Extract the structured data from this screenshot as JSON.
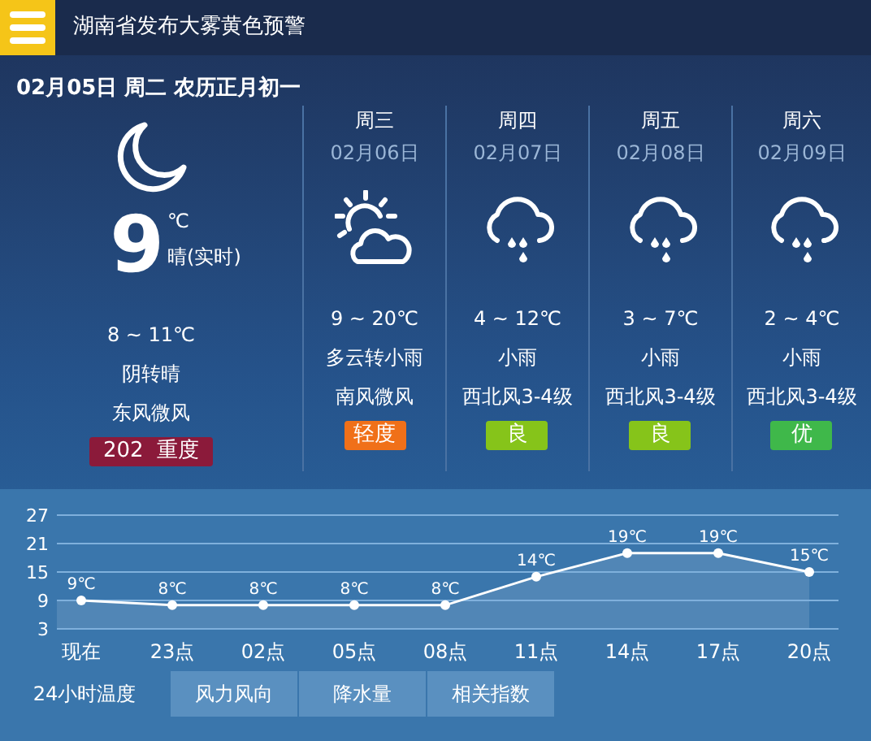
{
  "header": {
    "title": "湖南省发布大雾黄色预警"
  },
  "date_line": "02月05日 周二 农历正月初一",
  "today": {
    "kind": "moon",
    "temp": "9",
    "unit": "℃",
    "desc": "晴(实时)",
    "range": "8 ~ 11℃",
    "weather": "阴转晴",
    "wind": "东风微风",
    "aqi": {
      "label": "202  重度",
      "color": "#8b1a3a"
    }
  },
  "forecast": [
    {
      "day": "周三",
      "date": "02月06日",
      "kind": "sun-cloud",
      "range": "9 ~ 20℃",
      "weather": "多云转小雨",
      "wind": "南风微风",
      "aqi": {
        "label": "轻度",
        "color": "#f07019"
      }
    },
    {
      "day": "周四",
      "date": "02月07日",
      "kind": "rain",
      "range": "4 ~ 12℃",
      "weather": "小雨",
      "wind": "西北风3-4级",
      "aqi": {
        "label": "良",
        "color": "#86c41a"
      }
    },
    {
      "day": "周五",
      "date": "02月08日",
      "kind": "rain",
      "range": "3 ~ 7℃",
      "weather": "小雨",
      "wind": "西北风3-4级",
      "aqi": {
        "label": "良",
        "color": "#86c41a"
      }
    },
    {
      "day": "周六",
      "date": "02月09日",
      "kind": "rain",
      "range": "2 ~ 4℃",
      "weather": "小雨",
      "wind": "西北风3-4级",
      "aqi": {
        "label": "优",
        "color": "#3fb84a"
      }
    }
  ],
  "chart_data": {
    "type": "line",
    "categories": [
      "现在",
      "23点",
      "02点",
      "05点",
      "08点",
      "11点",
      "14点",
      "17点",
      "20点"
    ],
    "series": [
      {
        "color": "#ffffff",
        "marker": true,
        "values": [
          9,
          8,
          8,
          8,
          8,
          14,
          19,
          19,
          15
        ]
      }
    ],
    "grid": true,
    "ylim": [
      3,
      27
    ],
    "yticks": [
      3,
      9,
      15,
      21,
      27
    ],
    "value_labels": [
      "9℃",
      "8℃",
      "8℃",
      "8℃",
      "8℃",
      "14℃",
      "19℃",
      "19℃",
      "15℃"
    ]
  },
  "tabs": [
    {
      "label": "24小时温度",
      "selected": true
    },
    {
      "label": "风力风向",
      "selected": false
    },
    {
      "label": "降水量",
      "selected": false
    },
    {
      "label": "相关指数",
      "selected": false
    }
  ]
}
